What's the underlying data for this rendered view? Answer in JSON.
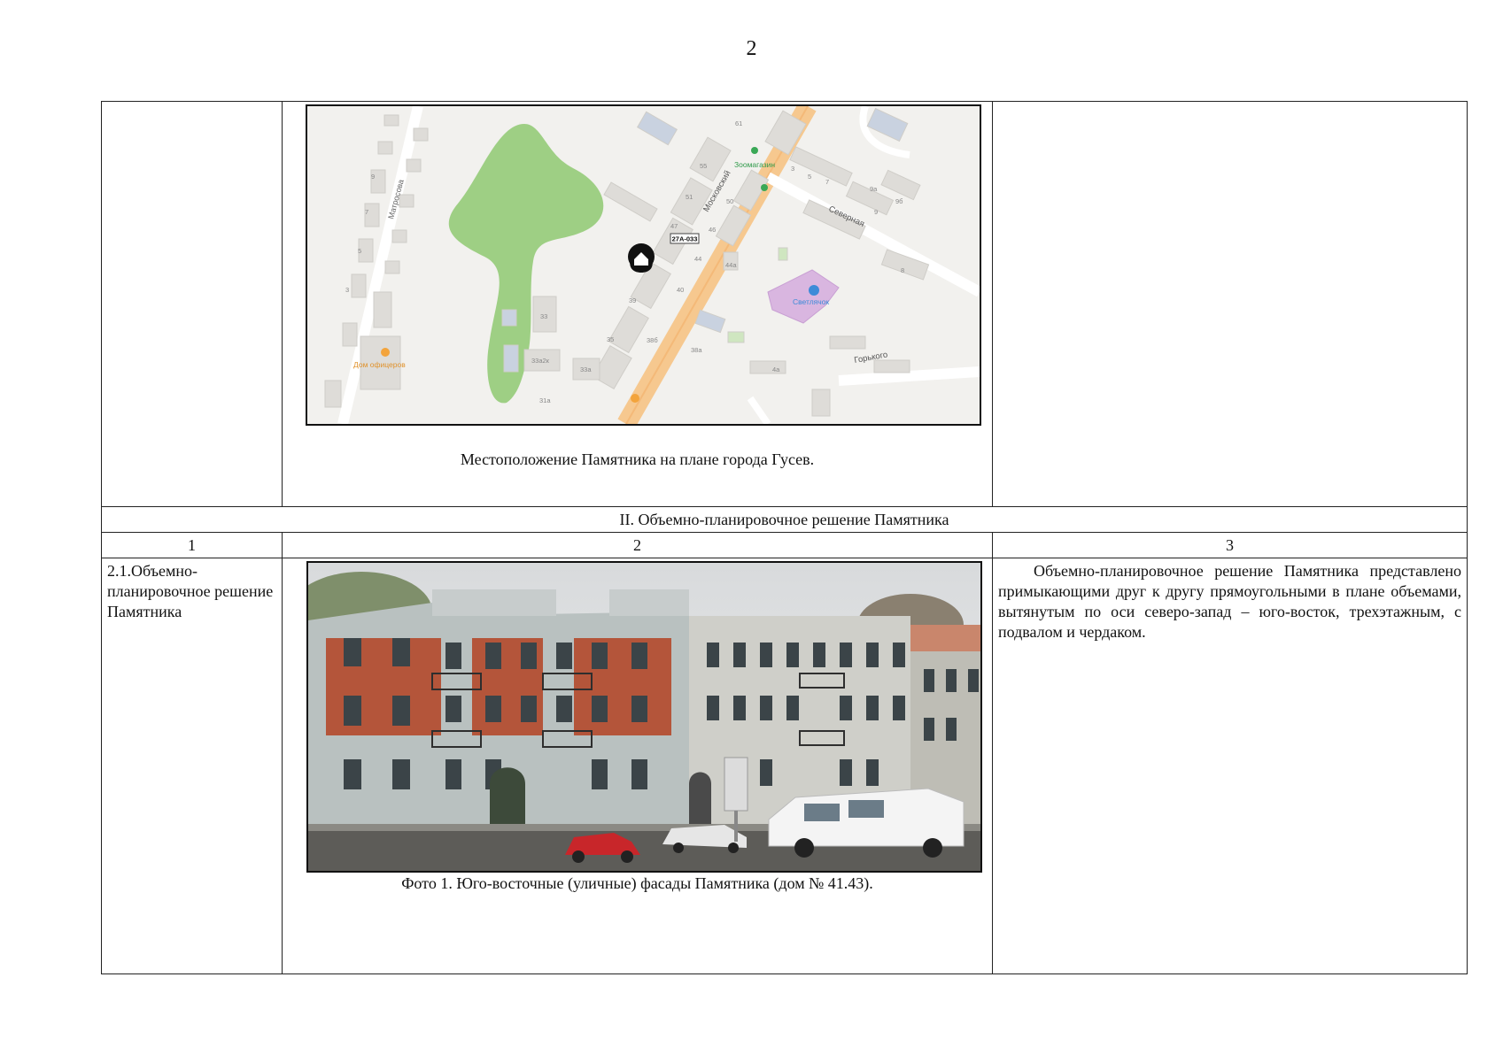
{
  "page_number": "2",
  "map": {
    "caption": "Местоположение Памятника на плане города Гусев.",
    "labels": {
      "street_matrosova": "Матросова",
      "street_moskovsky": "Московский",
      "street_severnaya": "Северная",
      "street_gorkogo": "Горького",
      "road_code": "27А-033",
      "poi_zoo_shop": "Зоомагазин",
      "poi_svetlyachok": "Светлячок",
      "poi_officers_house": "Дом офицеров"
    },
    "house_numbers": [
      "61",
      "55",
      "51",
      "47",
      "39",
      "35",
      "33",
      "33а",
      "33а2к",
      "31а",
      "50",
      "46",
      "44",
      "44а",
      "40",
      "38б",
      "38а",
      "4а",
      "3",
      "5",
      "7",
      "9",
      "9а",
      "9б",
      "8",
      "9",
      "7",
      "5",
      "3"
    ]
  },
  "section": {
    "heading": "II. Объемно-планировочное решение Памятника",
    "column_numbers": [
      "1",
      "2",
      "3"
    ],
    "feature_label": "2.1.Объемно-планировочное решение Памятника",
    "photo_caption": "Фото 1. Юго-восточные (уличные) фасады Памятника (дом № 41.43).",
    "description": "Объемно-планировочное решение Памятника представлено примыкающими друг к другу прямоугольными в плане объемами, вытянутым по оси северо-запад – юго-восток, трехэтажным, с подвалом и чердаком."
  }
}
